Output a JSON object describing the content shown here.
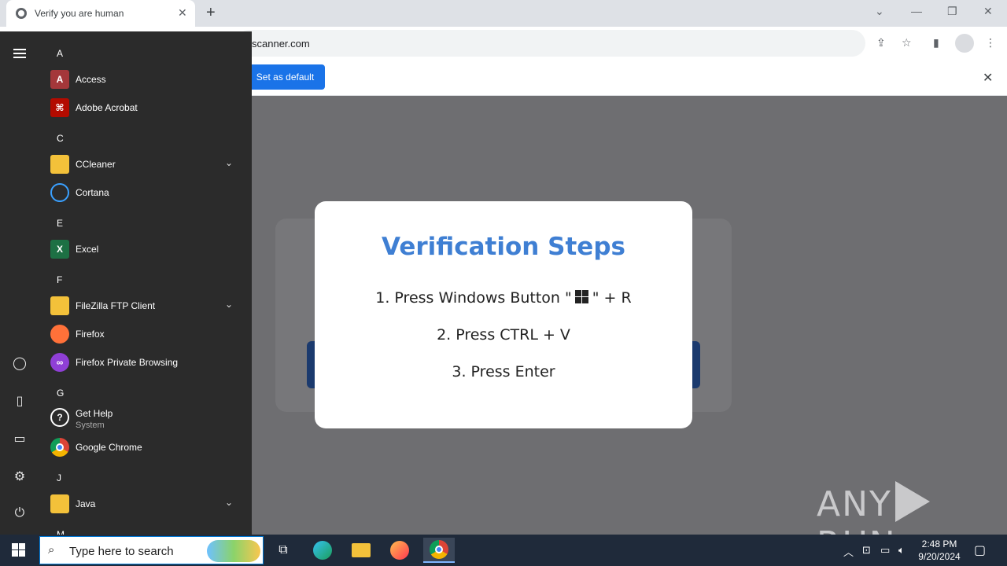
{
  "browser": {
    "tab_title": "Verify you are human",
    "url_visible": "scanner.com",
    "infobar_button": "Set as default"
  },
  "modal": {
    "title": "Verification Steps",
    "step1_pre": "1. Press Windows Button \"",
    "step1_post": "\" + R",
    "step2": "2. Press CTRL + V",
    "step3": "3. Press Enter",
    "title_color": "#3f7fd3"
  },
  "watermark": {
    "left": "ANY",
    "right": "RUN"
  },
  "start_menu": {
    "letters": {
      "a": "A",
      "c": "C",
      "e": "E",
      "f": "F",
      "g": "G",
      "j": "J",
      "m": "M"
    },
    "apps": {
      "access": "Access",
      "acrobat": "Adobe Acrobat",
      "ccleaner": "CCleaner",
      "cortana": "Cortana",
      "excel": "Excel",
      "filezilla": "FileZilla FTP Client",
      "firefox": "Firefox",
      "firefox_private": "Firefox Private Browsing",
      "gethelp": "Get Help",
      "gethelp_sub": "System",
      "chrome": "Google Chrome",
      "java": "Java"
    }
  },
  "taskbar": {
    "search_placeholder": "Type here to search",
    "time": "2:48 PM",
    "date": "9/20/2024"
  }
}
